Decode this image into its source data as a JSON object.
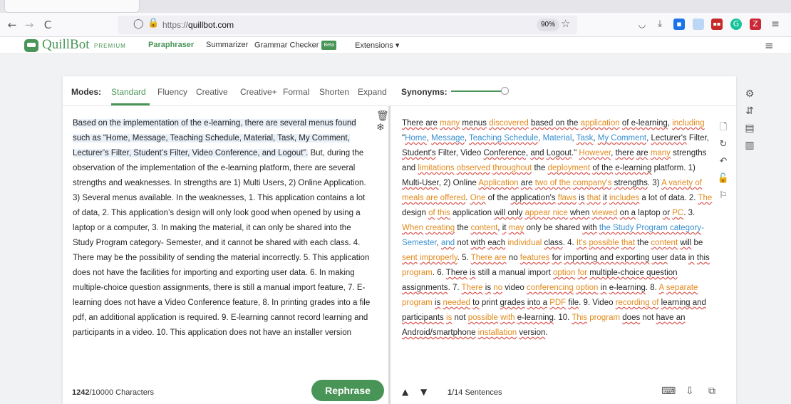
{
  "browser": {
    "url_protocol": "https://",
    "url_host": "quillbot.com",
    "zoom": "90%",
    "back_glyph": "←",
    "forward_glyph": "→",
    "reload_glyph": "C",
    "shield_glyph": "◯",
    "lock_glyph": "🔒",
    "star_glyph": "☆",
    "toolbar_icons": [
      "pocket-icon",
      "download-icon",
      "extension-blue-icon",
      "notes-icon",
      "extension-red-icon",
      "grammarly-icon",
      "zotero-icon",
      "menu-icon"
    ]
  },
  "header": {
    "logo_text": "QuillBot",
    "premium": "PREMIUM",
    "nav": [
      "Paraphraser",
      "Summarizer",
      "Grammar Checker",
      "Extensions ▾"
    ],
    "beta": "Beta",
    "menu_glyph": "≡"
  },
  "modes": {
    "label": "Modes:",
    "items": [
      "Standard",
      "Fluency",
      "Creative",
      "Creative+",
      "Formal",
      "Shorten",
      "Expand"
    ],
    "active": "Standard",
    "synonyms_label": "Synonyms:"
  },
  "input": {
    "highlighted": "Based on the implementation of the e-learning, there are several menus found such as “Home, Message, Teaching Schedule, Material, Task, My Comment, Lecturer’s Filter, Student’s Filter, Video Conference, and Logout”.",
    "rest": " But, during the observation of the implementation of the e-learning platform, there are several strengths and weaknesses. In strengths are 1) Multi Users, 2) Online Application. 3) Several menus available. In the weaknesses, 1. This application contains a lot of data, 2. This application’s design will only look good when opened by using a laptop or a computer, 3. In making the material, it can only be shared into the Study Program category- Semester, and it cannot be shared with each class. 4. There may be the possibility of sending the material incorrectly. 5. This application does not have the facilities for importing and exporting user data. 6. In making multiple-choice question assignments, there is still a manual import feature, 7. E-learning does not have a Video Conference feature, 8. In printing grades into a file pdf, an additional application is required. 9. E-learning cannot record learning and participants in a video. 10. This application does not have an installer version",
    "char_count": "1242",
    "char_max": "/10000 Characters",
    "rephrase": "Rephrase"
  },
  "output": {
    "sentences": "1",
    "sentences_total": "/14 Sentences"
  },
  "colors": {
    "brand": "#499557",
    "changed": "#e28a1d",
    "structural": "#3a8fd0"
  }
}
